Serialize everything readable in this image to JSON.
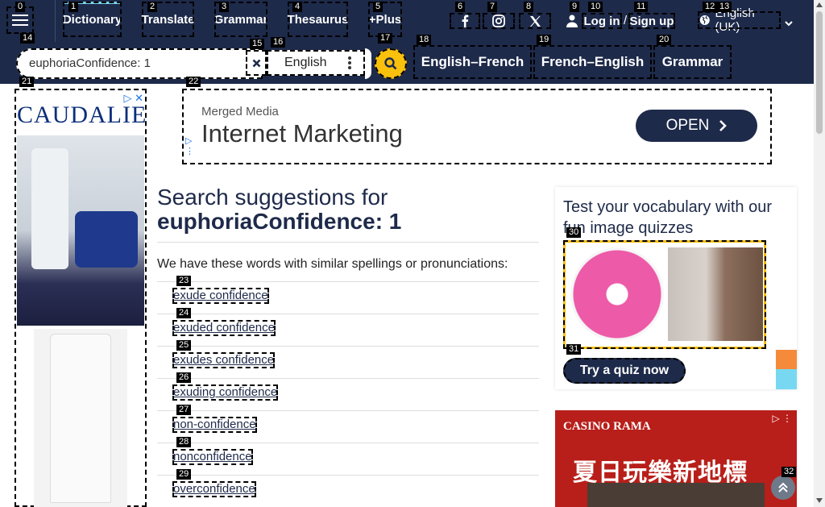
{
  "nav": {
    "tabs": [
      "Dictionary",
      "Translate",
      "Grammar",
      "Thesaurus",
      "+Plus"
    ],
    "login": "Log in",
    "signup": "Sign up",
    "language": "English (UK)"
  },
  "search": {
    "query": "euphoriaConfidence: 1",
    "dictionary": "English",
    "links": [
      "English–French",
      "French–English",
      "Grammar"
    ]
  },
  "ad_left": {
    "brand": "CAUDALIE"
  },
  "ad_top": {
    "advertiser": "Merged Media",
    "headline": "Internet Marketing",
    "button": "OPEN"
  },
  "main": {
    "heading_prefix": "Search suggestions for",
    "heading_query": "euphoriaConfidence: 1",
    "intro": "We have these words with similar spellings or pronunciations:",
    "suggestions": [
      "exude confidence",
      "exuded confidence",
      "exudes confidence",
      "exuding confidence",
      "non-confidence",
      "nonconfidence",
      "overconfidence"
    ]
  },
  "quiz": {
    "title": "Test your vocabulary with our fun image quizzes",
    "button": "Try a quiz now"
  },
  "ad_bottom": {
    "logo": "CASINO RAMA",
    "text": "夏日玩樂新地標"
  },
  "labels": [
    "0",
    "1",
    "2",
    "3",
    "4",
    "5",
    "6",
    "7",
    "8",
    "9",
    "10",
    "11",
    "12",
    "13",
    "14",
    "15",
    "16",
    "17",
    "18",
    "19",
    "20",
    "21",
    "22",
    "23",
    "24",
    "25",
    "26",
    "27",
    "28",
    "29",
    "30",
    "31",
    "32"
  ],
  "colors": {
    "nav_bg": "#1e2a4a",
    "accent": "#f9c00c"
  },
  "icons": [
    "menu-icon",
    "facebook-icon",
    "instagram-icon",
    "x-icon",
    "user-icon",
    "globe-icon",
    "chevron-down-icon",
    "close-icon",
    "more-vertical-icon",
    "search-icon",
    "ad-choices-icon",
    "chevron-right-icon",
    "arrow-up-icon"
  ]
}
